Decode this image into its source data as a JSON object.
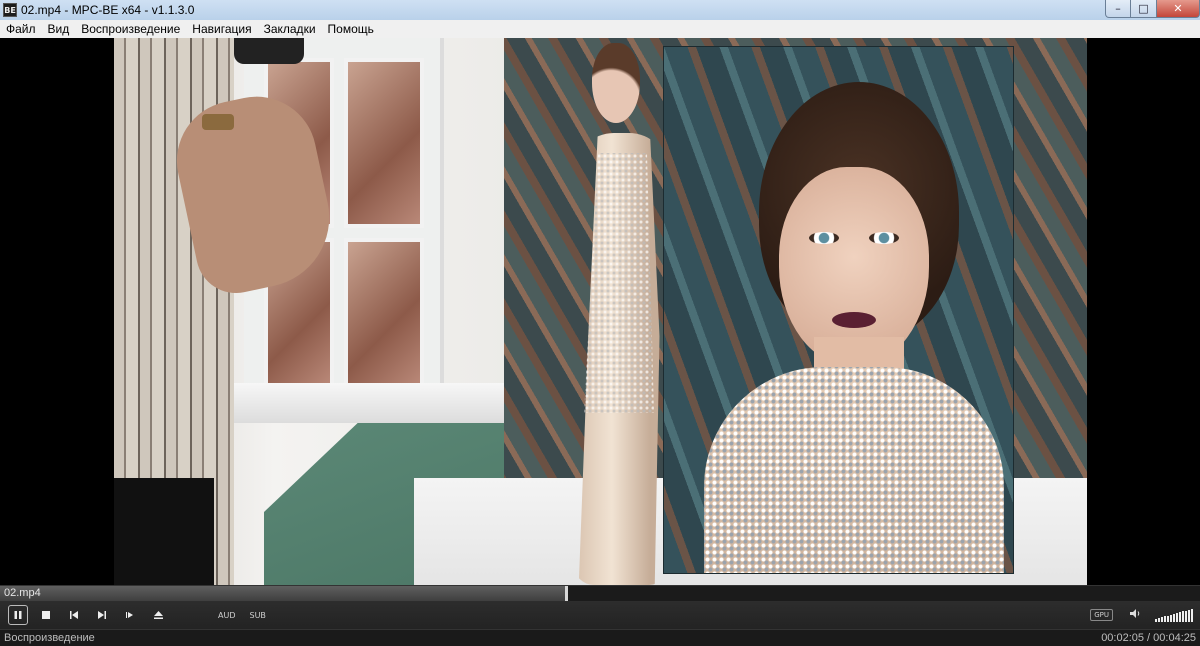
{
  "window": {
    "title": "02.mp4 - MPC-BE x64 - v1.1.3.0",
    "icon_label": "BE",
    "minimize": "–",
    "maximize": "□",
    "close": "✕"
  },
  "menu": [
    "Файл",
    "Вид",
    "Воспроизведение",
    "Навигация",
    "Закладки",
    "Помощь"
  ],
  "seek": {
    "file_name": "02.mp4",
    "progress": 0.4717
  },
  "controls": {
    "pause_icon": "pause-icon",
    "stop_icon": "stop-icon",
    "prev_icon": "skip-previous-icon",
    "next_icon": "skip-next-icon",
    "frame_step_icon": "frame-step-icon",
    "eject_icon": "eject-icon",
    "audio_label": "AUD",
    "subtitle_label": "SUB",
    "gpu_label": "GPU",
    "volume_icon": "speaker-icon",
    "volume_level": 1.0
  },
  "status": {
    "state": "Воспроизведение",
    "time": "00:02:05 / 00:04:25"
  },
  "colors": {
    "titlebar": "#b9d1ea",
    "controls_bg": "#232323",
    "seek_fill": "#4f4f4f"
  }
}
